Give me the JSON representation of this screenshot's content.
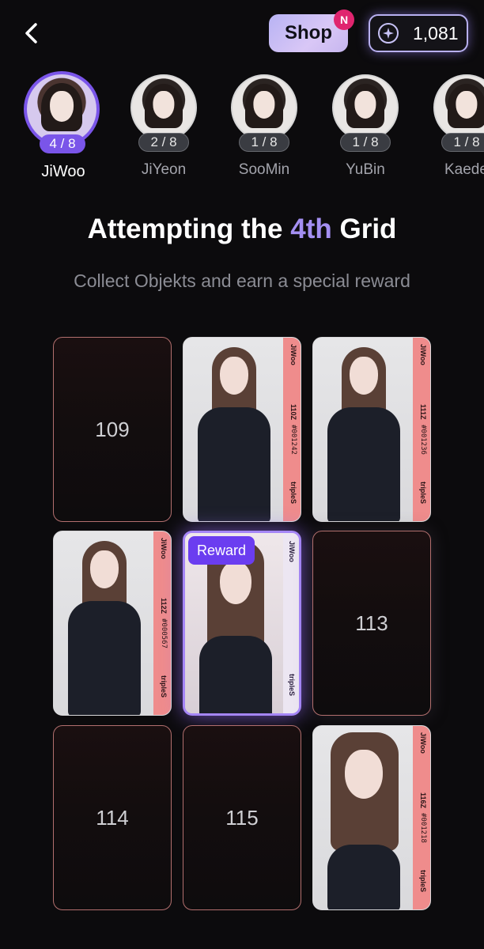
{
  "header": {
    "shop_label": "Shop",
    "shop_badge": "N",
    "coin_value": "1,081",
    "icons": {
      "back": "chevron-left-icon",
      "coin": "star-coin-icon"
    }
  },
  "members": [
    {
      "name": "JiWoo",
      "progress": "4 / 8",
      "active": true
    },
    {
      "name": "JiYeon",
      "progress": "2 / 8",
      "active": false
    },
    {
      "name": "SooMin",
      "progress": "1 / 8",
      "active": false
    },
    {
      "name": "YuBin",
      "progress": "1 / 8",
      "active": false
    },
    {
      "name": "Kaede",
      "progress": "1 / 8",
      "active": false
    }
  ],
  "heading": {
    "prefix": "Attempting the",
    "accent": "4th",
    "suffix": "Grid"
  },
  "subheading": "Collect Objekts and earn a special reward",
  "grid": {
    "cells": [
      {
        "type": "empty",
        "number": "109"
      },
      {
        "type": "objekt",
        "member": "JiWoo",
        "serial": "#001242",
        "code": "110Z",
        "brand": "tripleS"
      },
      {
        "type": "objekt",
        "member": "JiWoo",
        "serial": "#001236",
        "code": "111Z",
        "brand": "tripleS"
      },
      {
        "type": "objekt",
        "member": "JiWoo",
        "serial": "#000567",
        "code": "112Z",
        "brand": "tripleS"
      },
      {
        "type": "reward",
        "badge": "Reward",
        "member": "JiWoo",
        "brand": "tripleS"
      },
      {
        "type": "empty",
        "number": "113"
      },
      {
        "type": "empty",
        "number": "114"
      },
      {
        "type": "empty",
        "number": "115"
      },
      {
        "type": "objekt",
        "member": "JiWoo",
        "serial": "#001218",
        "code": "116Z",
        "brand": "tripleS"
      }
    ]
  },
  "colors": {
    "accent": "#7a55e9",
    "accent_text": "#a48ff2",
    "card_strip": "#ef8c8c",
    "empty_border": "#b26f6e",
    "background": "#0c0b0d"
  }
}
